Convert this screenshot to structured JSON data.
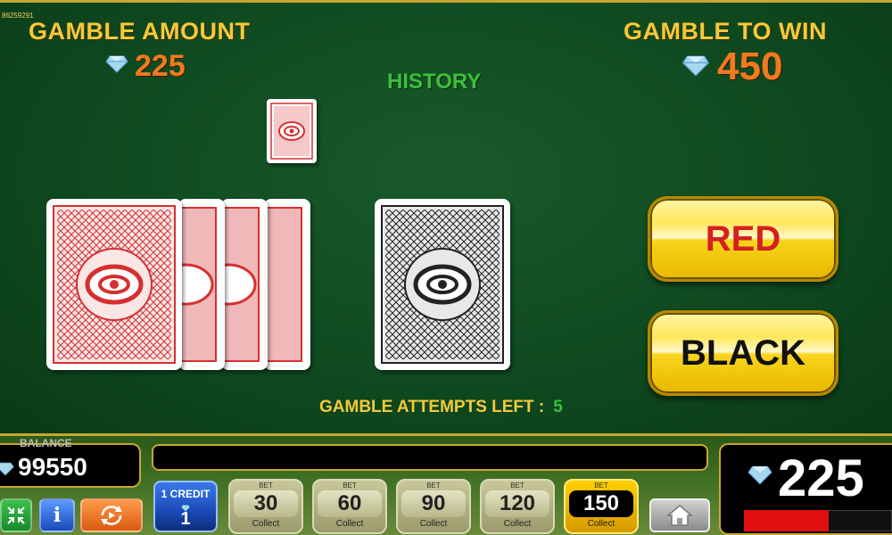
{
  "top": {
    "id_text": "86259291",
    "gamble_amount_label": "GAMBLE AMOUNT",
    "gamble_amount_value": "225",
    "gamble_to_win_label": "GAMBLE TO WIN",
    "gamble_to_win_value": "450",
    "history_label": "HISTORY"
  },
  "history": [
    {
      "color": "red"
    }
  ],
  "deck": {
    "color": "red",
    "stacked_count": 4
  },
  "current_card": {
    "color": "black",
    "face": "down"
  },
  "buttons": {
    "red_label": "RED",
    "black_label": "BLACK"
  },
  "attempts": {
    "label": "GAMBLE ATTEMPTS LEFT :",
    "value": "5"
  },
  "bottom": {
    "balance_label": "BALANCE",
    "balance_value": "99550",
    "credit_label": "1 CREDIT",
    "credit_value": "1",
    "bets": [
      {
        "cap": "BET",
        "value": "30",
        "collect": "Collect",
        "active": false
      },
      {
        "cap": "BET",
        "value": "60",
        "collect": "Collect",
        "active": false
      },
      {
        "cap": "BET",
        "value": "90",
        "collect": "Collect",
        "active": false
      },
      {
        "cap": "BET",
        "value": "120",
        "collect": "Collect",
        "active": false
      },
      {
        "cap": "BET",
        "value": "150",
        "collect": "Collect",
        "active": true
      }
    ],
    "win_value": "225",
    "win_progress": 0.57
  },
  "colors": {
    "accent_gold": "#f5c93a",
    "value_orange": "#f07a20",
    "history_green": "#3cbf3c",
    "card_red": "#d43030",
    "card_black": "#222222"
  },
  "icons": [
    "diamond-icon",
    "fullscreen-icon",
    "info-icon",
    "autoplay-icon",
    "home-icon"
  ]
}
